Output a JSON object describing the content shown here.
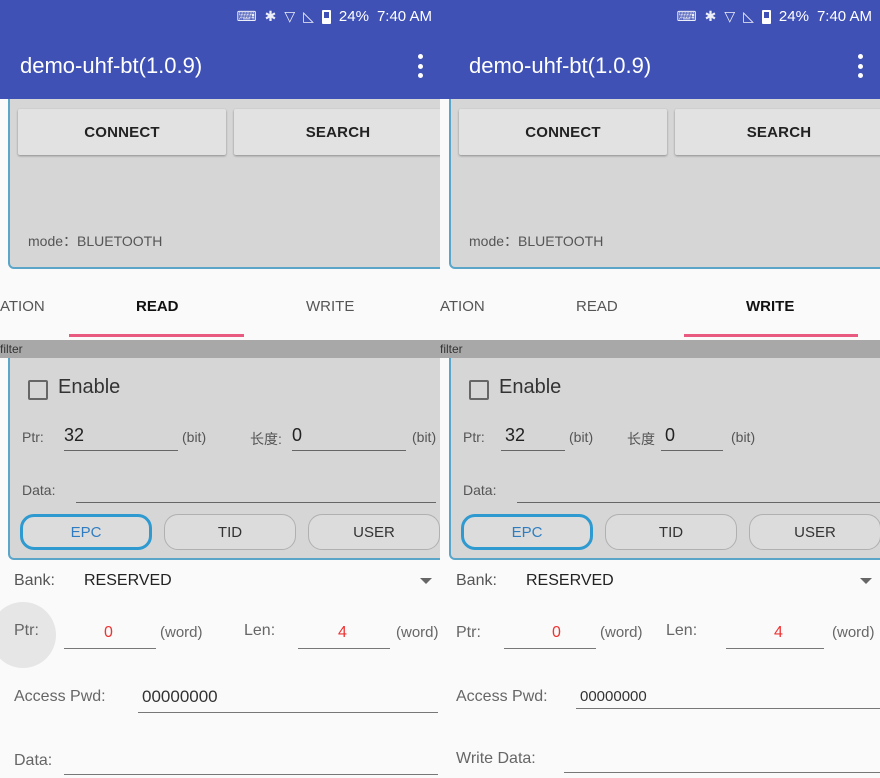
{
  "status": {
    "battery": "24%",
    "time": "7:40 AM"
  },
  "app": {
    "title": "demo-uhf-bt(1.0.9)"
  },
  "panels": [
    {
      "top": {
        "connect": "CONNECT",
        "search": "SEARCH",
        "mode": "mode：BLUETOOTH"
      },
      "tabs": {
        "t1": "ATION",
        "t2": "READ",
        "t3": "WRITE"
      },
      "filter": {
        "header": "filter",
        "enable": "Enable",
        "ptr_label": "Ptr:",
        "ptr_value": "32",
        "bit1": "(bit)",
        "len_label": "长度:",
        "len_value": "0",
        "bit2": "(bit)",
        "data_label": "Data:",
        "seg_epc": "EPC",
        "seg_tid": "TID",
        "seg_user": "USER"
      },
      "form": {
        "bank_label": "Bank:",
        "bank_value": "RESERVED",
        "ptr_label": "Ptr:",
        "ptr_value": "0",
        "word1": "(word)",
        "len_label": "Len:",
        "len_value": "4",
        "word2": "(word)",
        "access_label": "Access Pwd:",
        "access_value": "00000000",
        "data_label": "Data:"
      }
    },
    {
      "top": {
        "connect": "CONNECT",
        "search": "SEARCH",
        "mode": "mode：BLUETOOTH"
      },
      "tabs": {
        "t1": "ATION",
        "t2": "READ",
        "t3": "WRITE"
      },
      "filter": {
        "header": "filter",
        "enable": "Enable",
        "ptr_label": "Ptr:",
        "ptr_value": "32",
        "bit1": "(bit)",
        "len_label": "长度",
        "len_value": "0",
        "bit2": "(bit)",
        "data_label": "Data:",
        "seg_epc": "EPC",
        "seg_tid": "TID",
        "seg_user": "USER"
      },
      "form": {
        "bank_label": "Bank:",
        "bank_value": "RESERVED",
        "ptr_label": "Ptr:",
        "ptr_value": "0",
        "word1": "(word)",
        "len_label": "Len:",
        "len_value": "4",
        "word2": "(word)",
        "access_label": "Access Pwd:",
        "access_value": "00000000",
        "data_label": "Write Data:"
      }
    }
  ],
  "colors": {
    "primary": "#3f51b5",
    "accent": "#e85a7f",
    "outline": "#5aa5c8",
    "epc": "#2f9ad0",
    "value_red": "#e33333"
  }
}
